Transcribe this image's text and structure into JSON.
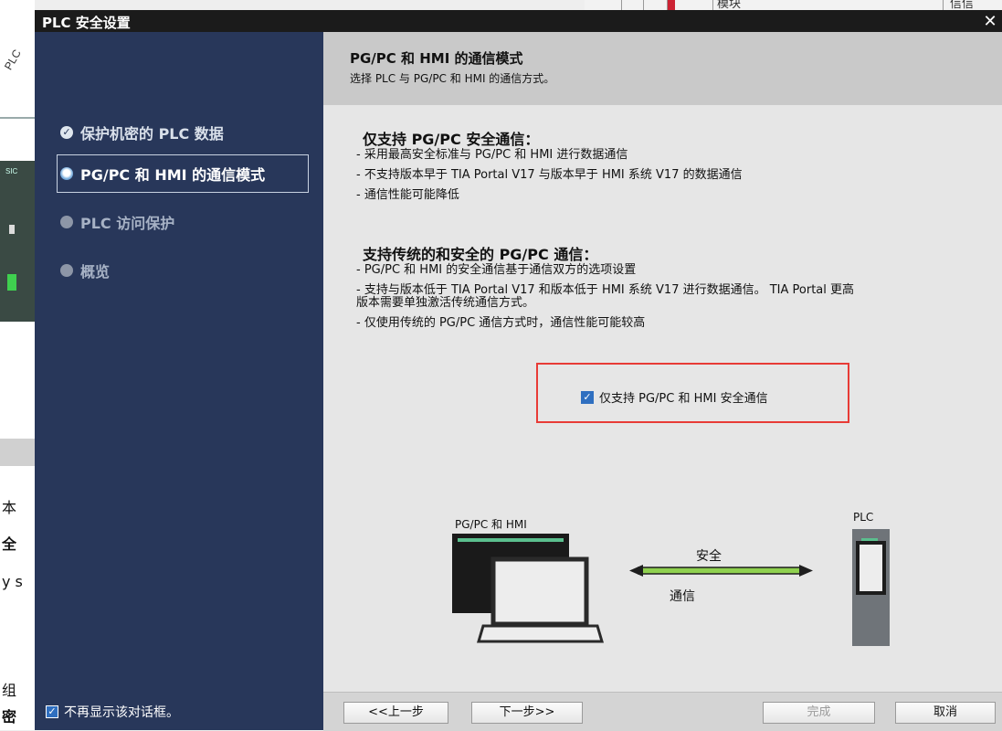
{
  "background": {
    "rot_label": "PLC",
    "sic_label": "SIC",
    "fragments": [
      "本",
      "全",
      "y s",
      "组",
      "密"
    ],
    "top_module": "模块",
    "top_info": "信信"
  },
  "dialog": {
    "title": "PLC 安全设置",
    "close_glyph": "✕"
  },
  "nav": {
    "items": [
      {
        "label": "保护机密的 PLC 数据",
        "state": "done"
      },
      {
        "label": "PG/PC 和 HMI 的通信模式",
        "state": "active"
      },
      {
        "label": "PLC 访问保护",
        "state": "pending"
      },
      {
        "label": "概览",
        "state": "pending"
      }
    ],
    "dont_show_label": "不再显示该对话框。",
    "dont_show_checked": true
  },
  "header": {
    "title": "PG/PC 和 HMI 的通信模式",
    "subtitle": "选择 PLC 与 PG/PC 和 HMI 的通信方式。"
  },
  "sections": {
    "secure_only": {
      "title": "仅支持 PG/PC 安全通信：",
      "lines": [
        "- 采用最高安全标准与 PG/PC 和 HMI 进行数据通信",
        "- 不支持版本早于 TIA Portal V17 与版本早于 HMI 系统 V17 的数据通信",
        "- 通信性能可能降低"
      ]
    },
    "legacy": {
      "title": "支持传统的和安全的 PG/PC 通信：",
      "lines": [
        "- PG/PC 和 HMI 的安全通信基于通信双方的选项设置",
        "- 支持与版本低于 TIA Portal V17 和版本低于 HMI 系统 V17 进行数据通信。 TIA Portal 更高",
        "版本需要单独激活传统通信方式。",
        "- 仅使用传统的 PG/PC 通信方式时，通信性能可能较高"
      ]
    }
  },
  "option": {
    "label": "仅支持 PG/PC 和 HMI 安全通信",
    "checked": true
  },
  "diagram": {
    "left_label": "PG/PC 和 HMI",
    "right_label": "PLC",
    "arrow_top": "安全",
    "arrow_bottom": "通信"
  },
  "footer": {
    "back": "<<上一步",
    "next": "下一步>>",
    "finish": "完成",
    "cancel": "取消"
  },
  "colors": {
    "nav_bg": "#28375a",
    "highlight": "#e83b36",
    "checkbox": "#2f6fc0",
    "arrow_green": "#8fd14f"
  }
}
